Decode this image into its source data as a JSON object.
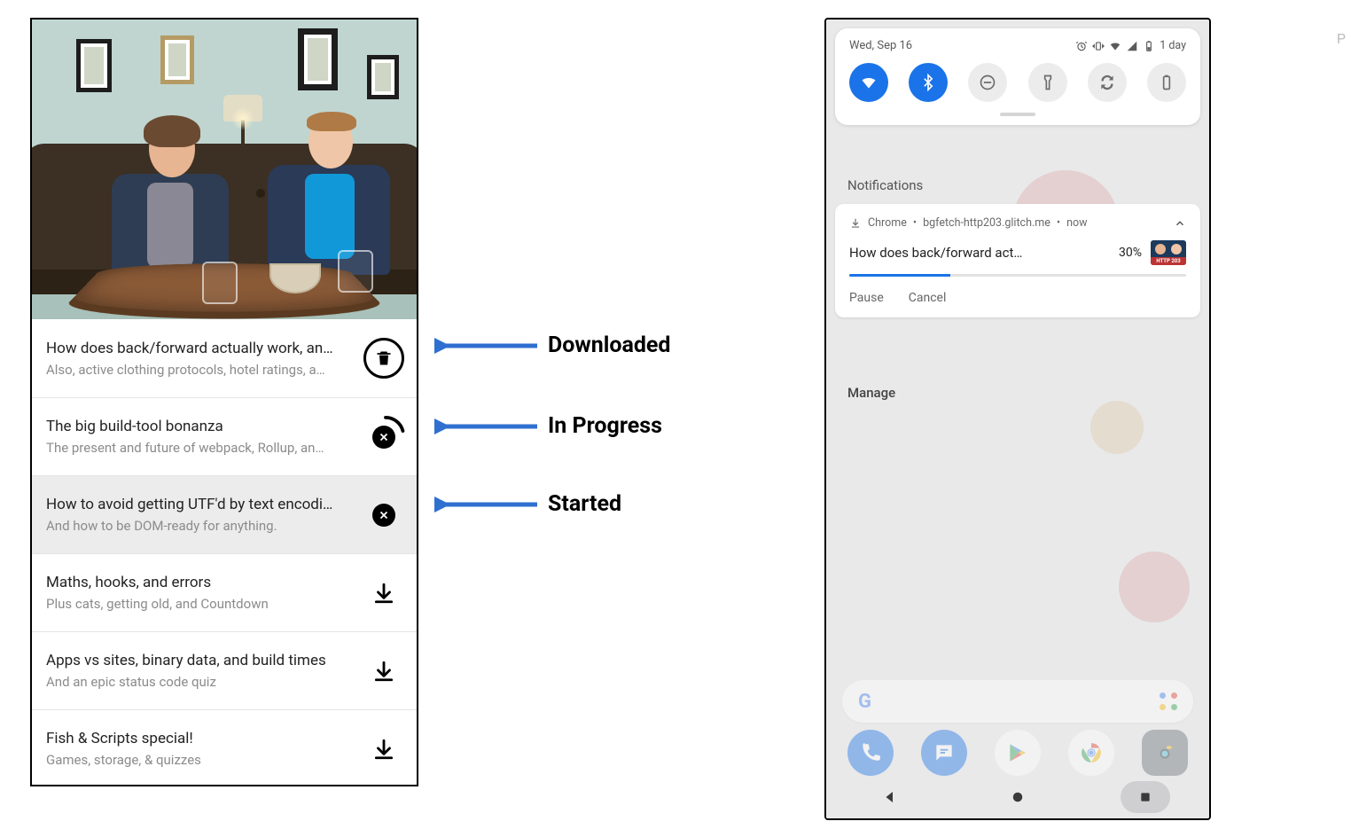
{
  "annotations": {
    "downloaded": "Downloaded",
    "in_progress": "In Progress",
    "started": "Started"
  },
  "arrow_color": "#2f6fd0",
  "episodes": [
    {
      "title": "How does back/forward actually work, an…",
      "subtitle": "Also, active clothing protocols, hotel ratings, a…",
      "action": "delete",
      "shaded": false
    },
    {
      "title": "The big build-tool bonanza",
      "subtitle": "The present and future of webpack, Rollup, an…",
      "action": "progress",
      "shaded": false
    },
    {
      "title": "How to avoid getting UTF'd by text encodi…",
      "subtitle": "And how to be DOM-ready for anything.",
      "action": "cancel",
      "shaded": true
    },
    {
      "title": "Maths, hooks, and errors",
      "subtitle": "Plus cats, getting old, and Countdown",
      "action": "download",
      "shaded": false
    },
    {
      "title": "Apps vs sites, binary data, and build times",
      "subtitle": "And an epic status code quiz",
      "action": "download",
      "shaded": false
    },
    {
      "title": "Fish & Scripts special!",
      "subtitle": "Games, storage, & quizzes",
      "action": "download",
      "shaded": false
    }
  ],
  "phone": {
    "date": "Wed, Sep 16",
    "battery_text": "1 day",
    "notifications_label": "Notifications",
    "manage_label": "Manage",
    "quick_toggles": [
      {
        "name": "wifi",
        "on": true
      },
      {
        "name": "bluetooth",
        "on": true
      },
      {
        "name": "dnd",
        "on": false
      },
      {
        "name": "flashlight",
        "on": false
      },
      {
        "name": "autorotate",
        "on": false
      },
      {
        "name": "battery",
        "on": false
      }
    ],
    "notification": {
      "app": "Chrome",
      "source": "bgfetch-http203.glitch.me",
      "time": "now",
      "title": "How does back/forward act…",
      "percent_text": "30%",
      "percent_value": 30,
      "thumb_label": "HTTP 203",
      "actions": {
        "pause": "Pause",
        "cancel": "Cancel"
      }
    }
  },
  "corner_marker": "P"
}
